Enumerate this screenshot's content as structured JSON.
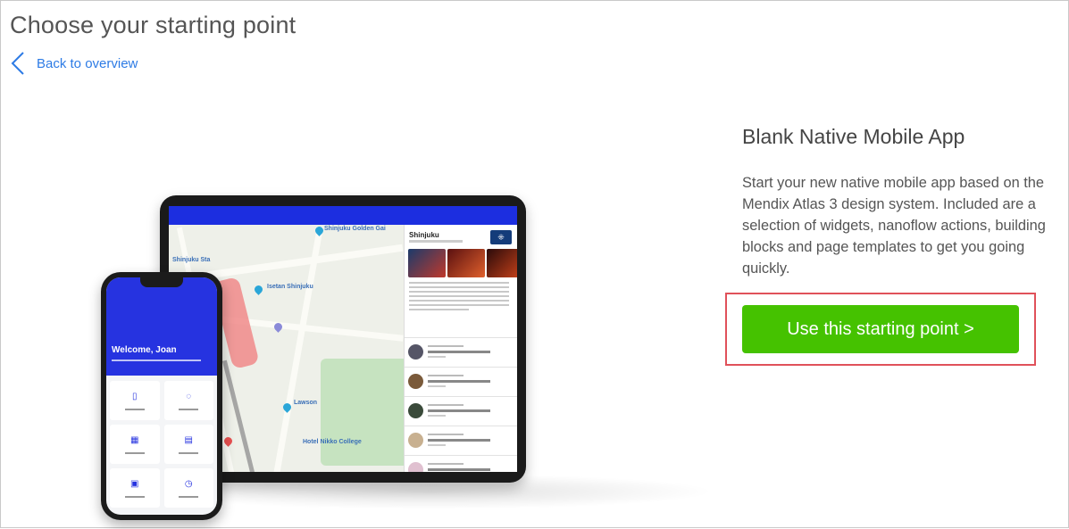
{
  "page": {
    "title": "Choose your starting point",
    "back_label": "Back to overview"
  },
  "template": {
    "name": "Blank Native Mobile App",
    "description": "Start your new native mobile app based on the Mendix Atlas 3 design system. Included are a selection of widgets, nanoflow actions, building blocks and page templates to get you going quickly.",
    "cta_label": "Use this starting point >"
  },
  "preview": {
    "tablet": {
      "panel_title": "Shinjuku",
      "map_labels": [
        "Shinjuku Golden Gai",
        "Isetan Shinjuku",
        "Shinjuku Sta",
        "Lawson",
        "Hotel Nikko College"
      ]
    },
    "phone": {
      "welcome": "Welcome, Joan",
      "tiles": [
        {
          "icon": "book-icon",
          "glyph": "▯"
        },
        {
          "icon": "chat-icon",
          "glyph": "◌"
        },
        {
          "icon": "map-icon",
          "glyph": "▦"
        },
        {
          "icon": "calendar-icon",
          "glyph": "▤"
        },
        {
          "icon": "photo-icon",
          "glyph": "▣"
        },
        {
          "icon": "alarm-icon",
          "glyph": "◷"
        }
      ]
    }
  },
  "colors": {
    "accent": "#2d7be5",
    "cta": "#45c200",
    "highlight": "#e0515a",
    "phone_header": "#2633e0"
  }
}
